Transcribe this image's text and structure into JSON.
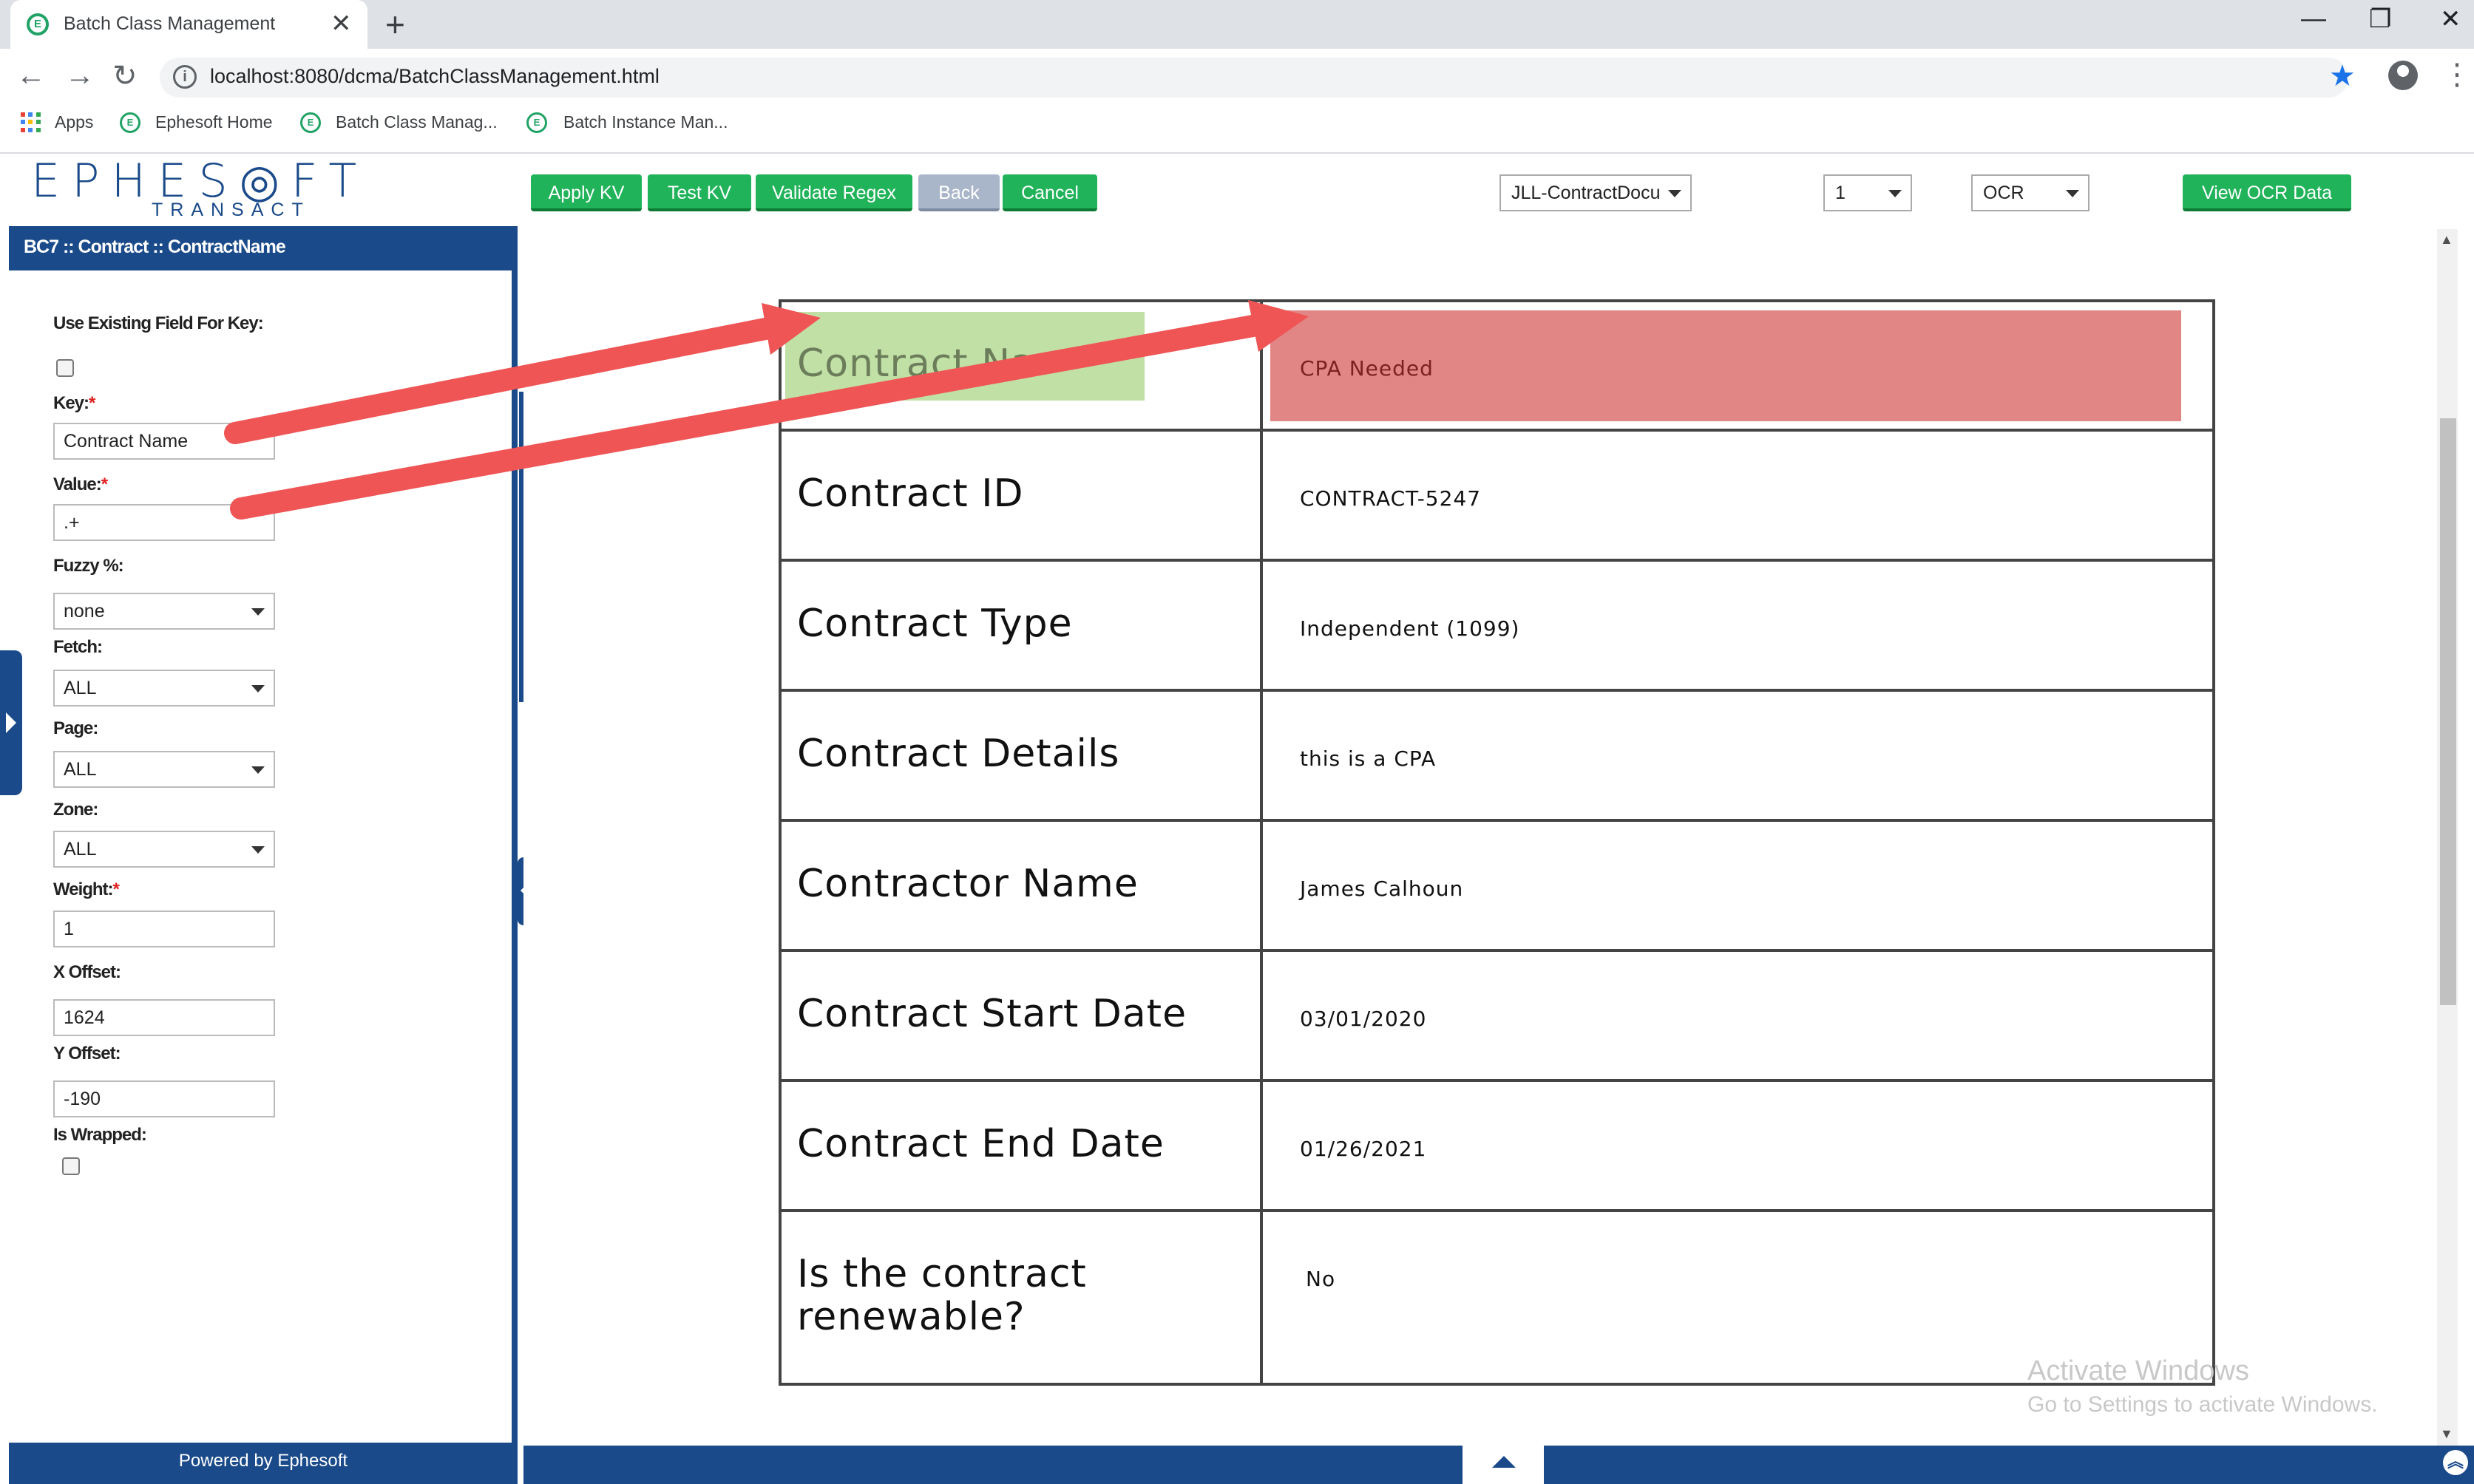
{
  "browser": {
    "tab_title": "Batch Class Management",
    "tab_close": "✕",
    "new_tab": "+",
    "url": "localhost:8080/dcma/BatchClassManagement.html",
    "window_controls": {
      "minimize": "—",
      "restore": "❐",
      "close": "✕"
    },
    "nav": {
      "back": "←",
      "forward": "→",
      "reload": "↻"
    },
    "bookmarks": [
      "Apps",
      "Ephesoft Home",
      "Batch Class Manag...",
      "Batch Instance Man..."
    ]
  },
  "header": {
    "logo": "EPHES◎FT",
    "logo_sub": "TRANSACT",
    "buttons": {
      "apply_kv": "Apply KV",
      "test_kv": "Test KV",
      "validate_regex": "Validate Regex",
      "back": "Back",
      "cancel": "Cancel",
      "view_ocr": "View OCR Data"
    },
    "dropdowns": {
      "document": "JLL-ContractDocu",
      "page": "1",
      "mode": "OCR"
    }
  },
  "panel": {
    "title": "BC7 :: Contract :: ContractName",
    "use_existing_label": "Use Existing Field For Key:",
    "key_label": "Key:",
    "key_value": "Contract Name",
    "value_label": "Value:",
    "value_value": ".+",
    "fuzzy_label": "Fuzzy %:",
    "fuzzy_value": "none",
    "fetch_label": "Fetch:",
    "fetch_value": "ALL",
    "page_label": "Page:",
    "page_value": "ALL",
    "zone_label": "Zone:",
    "zone_value": "ALL",
    "weight_label": "Weight:",
    "weight_value": "1",
    "xoffset_label": "X Offset:",
    "xoffset_value": "1624",
    "yoffset_label": "Y Offset:",
    "yoffset_value": "-190",
    "wrapped_label": "Is Wrapped:",
    "required_mark": "*",
    "footer": "Powered by Ephesoft"
  },
  "document": {
    "rows": [
      {
        "key": "Contract Na",
        "value": "CPA Needed"
      },
      {
        "key": "Contract ID",
        "value": "CONTRACT-5247"
      },
      {
        "key": "Contract Type",
        "value": "Independent (1099)"
      },
      {
        "key": "Contract Details",
        "value": "this is a CPA"
      },
      {
        "key": "Contractor Name",
        "value": "James Calhoun"
      },
      {
        "key": "Contract Start Date",
        "value": "03/01/2020"
      },
      {
        "key": "Contract End Date",
        "value": "01/26/2021"
      },
      {
        "key": "Is the contract",
        "key2": "renewable?",
        "value": "No"
      }
    ]
  },
  "watermark": {
    "line1": "Activate Windows",
    "line2": "Go to Settings to activate Windows."
  },
  "colors": {
    "brand_blue": "#1a4a8a",
    "button_green": "#21b35a",
    "key_highlight": "#c1e0a5",
    "value_highlight": "#e28585",
    "arrow_red": "#f05555"
  }
}
